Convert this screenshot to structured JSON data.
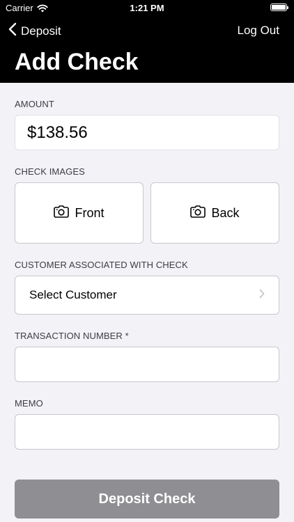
{
  "status_bar": {
    "carrier": "Carrier",
    "time": "1:21 PM"
  },
  "nav": {
    "back_label": "Deposit",
    "logout_label": "Log Out",
    "title": "Add Check"
  },
  "form": {
    "amount": {
      "label": "AMOUNT",
      "value": "$138.56"
    },
    "check_images": {
      "label": "CHECK IMAGES",
      "front_label": "Front",
      "back_label": "Back"
    },
    "customer": {
      "label": "CUSTOMER ASSOCIATED WITH CHECK",
      "value": "Select Customer"
    },
    "transaction_number": {
      "label": "TRANSACTION NUMBER *",
      "value": ""
    },
    "memo": {
      "label": "MEMO",
      "value": ""
    },
    "submit_label": "Deposit Check"
  },
  "colors": {
    "header_bg": "#000000",
    "page_bg": "#f2f2f7",
    "submit_disabled_bg": "#8e8e93"
  },
  "icons": {
    "back": "chevron-left-icon",
    "camera": "camera-icon",
    "disclosure": "chevron-right-icon",
    "wifi": "wifi-icon",
    "battery": "battery-icon"
  }
}
